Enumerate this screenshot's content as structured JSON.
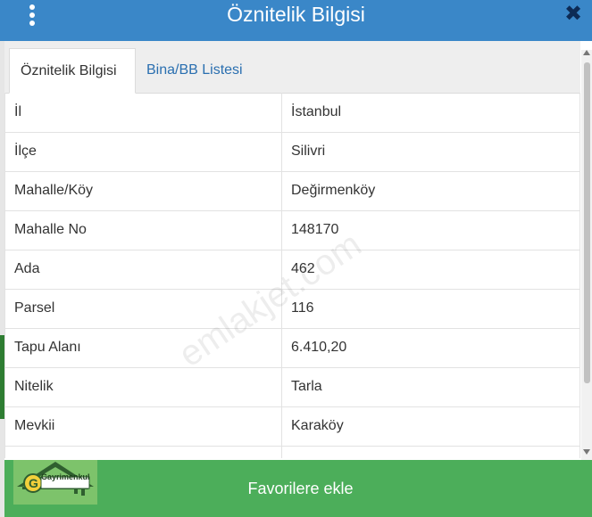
{
  "header": {
    "title": "Öznitelik Bilgisi"
  },
  "tabs": [
    {
      "label": "Öznitelik Bilgisi",
      "active": true
    },
    {
      "label": "Bina/BB Listesi",
      "active": false
    }
  ],
  "attributes": [
    {
      "key": "İl",
      "value": "İstanbul"
    },
    {
      "key": "İlçe",
      "value": "Silivri"
    },
    {
      "key": "Mahalle/Köy",
      "value": "Değirmenköy"
    },
    {
      "key": "Mahalle No",
      "value": "148170"
    },
    {
      "key": "Ada",
      "value": "462"
    },
    {
      "key": "Parsel",
      "value": "116"
    },
    {
      "key": "Tapu Alanı",
      "value": "6.410,20"
    },
    {
      "key": "Nitelik",
      "value": "Tarla"
    },
    {
      "key": "Mevkii",
      "value": "Karaköy"
    }
  ],
  "watermark": "emlakjet.com",
  "footer": {
    "button_label": "Favorilere ekle",
    "logo_text": "Gayrimenkul"
  },
  "colors": {
    "header": "#3a87c8",
    "footer": "#4cae5a",
    "tab_link": "#2a6fb0"
  }
}
